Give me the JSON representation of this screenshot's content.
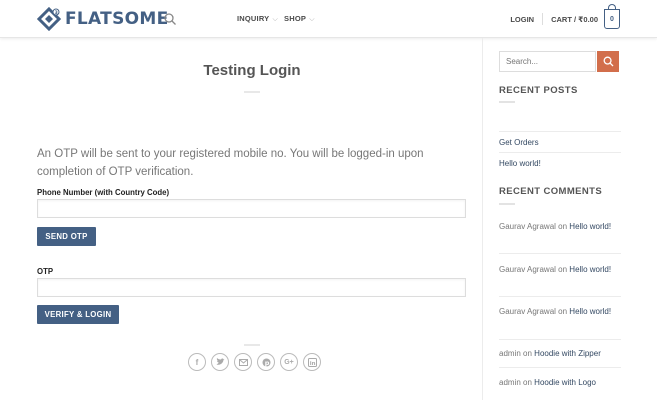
{
  "header": {
    "logo_text": "FLATSOME",
    "nav": [
      {
        "label": "INQUIRY"
      },
      {
        "label": "SHOP"
      }
    ],
    "login_label": "LOGIN",
    "cart_label": "CART / ₹0.00",
    "cart_count": "0"
  },
  "main": {
    "title": "Testing Login",
    "intro": "An OTP will be sent to your registered mobile no. You will be logged-in upon completion of OTP verification.",
    "phone_label": "Phone Number (with Country Code)",
    "phone_value": "",
    "send_otp_label": "SEND OTP",
    "otp_label": "OTP",
    "otp_value": "",
    "verify_label": "VERIFY & LOGIN",
    "share_icons": [
      "facebook-icon",
      "twitter-icon",
      "email-icon",
      "pinterest-icon",
      "google-plus-icon",
      "linkedin-icon"
    ]
  },
  "sidebar": {
    "search_placeholder": "Search...",
    "recent_posts_heading": "RECENT POSTS",
    "posts": [
      "Get Orders",
      "Hello world!"
    ],
    "recent_comments_heading": "RECENT COMMENTS",
    "comments": [
      {
        "author": "Gaurav Agrawal",
        "on": "on",
        "post": "Hello world!"
      },
      {
        "author": "Gaurav Agrawal",
        "on": "on",
        "post": "Hello world!"
      },
      {
        "author": "Gaurav Agrawal",
        "on": "on",
        "post": "Hello world!"
      },
      {
        "author": "admin",
        "on": "on",
        "post": "Hoodie with Zipper"
      },
      {
        "author": "admin",
        "on": "on",
        "post": "Hoodie with Logo"
      }
    ]
  },
  "colors": {
    "brand": "#446084",
    "accent": "#d26e4b",
    "link": "#334862"
  }
}
